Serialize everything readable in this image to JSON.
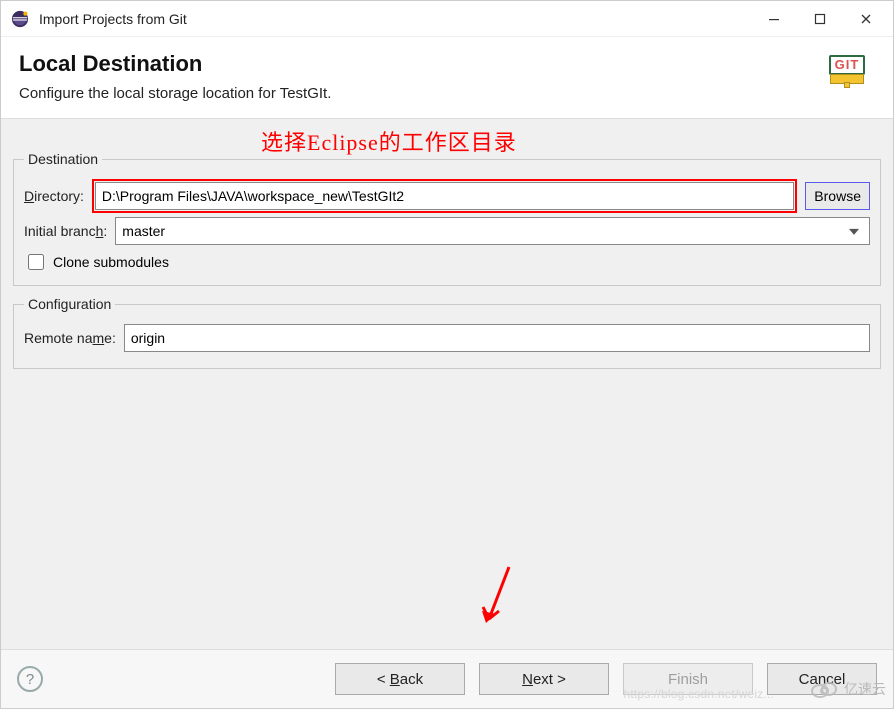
{
  "window": {
    "title": "Import Projects from Git"
  },
  "header": {
    "title": "Local Destination",
    "subtitle": "Configure the local storage location for TestGIt.",
    "git_badge": "GIT"
  },
  "annotation_text": "选择Eclipse的工作区目录",
  "destination": {
    "legend": "Destination",
    "directory_label": "Directory:",
    "directory_value": "D:\\Program Files\\JAVA\\workspace_new\\TestGIt2",
    "browse_label": "Browse",
    "initial_branch_label": "Initial branch:",
    "initial_branch_value": "master",
    "clone_submodules_label": "Clone submodules",
    "clone_submodules_checked": false
  },
  "configuration": {
    "legend": "Configuration",
    "remote_name_label": "Remote name:",
    "remote_name_value": "origin"
  },
  "buttons": {
    "help_symbol": "?",
    "back": "< Back",
    "next": "Next >",
    "finish": "Finish",
    "cancel": "Cancel"
  },
  "watermark": {
    "text": "亿速云",
    "faint_url": "https://blog.csdn.net/weiz..."
  }
}
